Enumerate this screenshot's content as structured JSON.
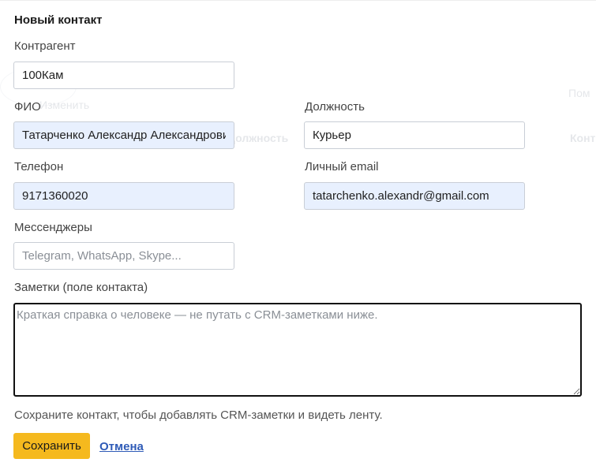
{
  "form": {
    "title": "Новый контакт",
    "counterparty": {
      "label": "Контрагент",
      "value": "100Кам"
    },
    "full_name": {
      "label": "ФИО",
      "value": "Татарченко Александр Александрович"
    },
    "position": {
      "label": "Должность",
      "value": "Курьер"
    },
    "phone": {
      "label": "Телефон",
      "value": "9171360020"
    },
    "personal_email": {
      "label": "Личный email",
      "value": "tatarchenko.alexandr@gmail.com"
    },
    "messengers": {
      "label": "Мессенджеры",
      "value": "",
      "placeholder": "Telegram, WhatsApp, Skype..."
    },
    "notes": {
      "label": "Заметки (поле контакта)",
      "value": "",
      "placeholder": "Краткая справка о человеке — не путать с CRM-заметками ниже."
    },
    "hint": "Сохраните контакт, чтобы добавлять CRM-заметки и видеть ленту.",
    "save_label": "Сохранить",
    "cancel_label": "Отмена"
  },
  "background": {
    "label_a": "Изменить",
    "label_b": "Должность",
    "label_c": "Конт",
    "label_d": "Пом"
  },
  "colors": {
    "accent_button": "#f5b91e",
    "link": "#2f5bb7",
    "autofill": "#e8f0fe"
  }
}
